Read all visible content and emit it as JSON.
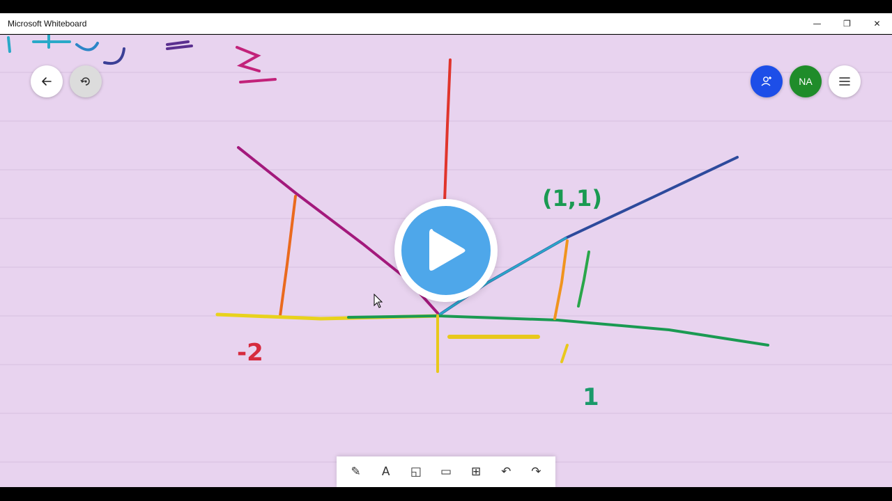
{
  "window": {
    "title": "Microsoft Whiteboard",
    "minimize_glyph": "—",
    "restore_glyph": "❐",
    "close_glyph": "✕"
  },
  "board": {
    "background_color": "#e8d3ef",
    "ink_labels": {
      "point": "(1,1)",
      "left_value": "-2",
      "bottom_value": "1"
    }
  },
  "top_controls": {
    "avatar_initials": "NA",
    "icons": [
      "arrow-left-icon",
      "undo-history-icon",
      "add-person-icon",
      "hamburger-menu-icon"
    ]
  },
  "toolbar": {
    "tools": [
      {
        "name": "pen-tool-icon",
        "glyph": "✎"
      },
      {
        "name": "text-tool-icon",
        "glyph": "A"
      },
      {
        "name": "sticky-note-icon",
        "glyph": "◱"
      },
      {
        "name": "image-icon",
        "glyph": "▭"
      },
      {
        "name": "insert-icon",
        "glyph": "⊞"
      },
      {
        "name": "undo-icon",
        "glyph": "↶"
      },
      {
        "name": "redo-icon",
        "glyph": "↷"
      }
    ]
  },
  "colors": {
    "accent_blue": "#1d4ee8",
    "avatar_green": "#1f8c2a",
    "play_blue": "#4ea7ea"
  }
}
